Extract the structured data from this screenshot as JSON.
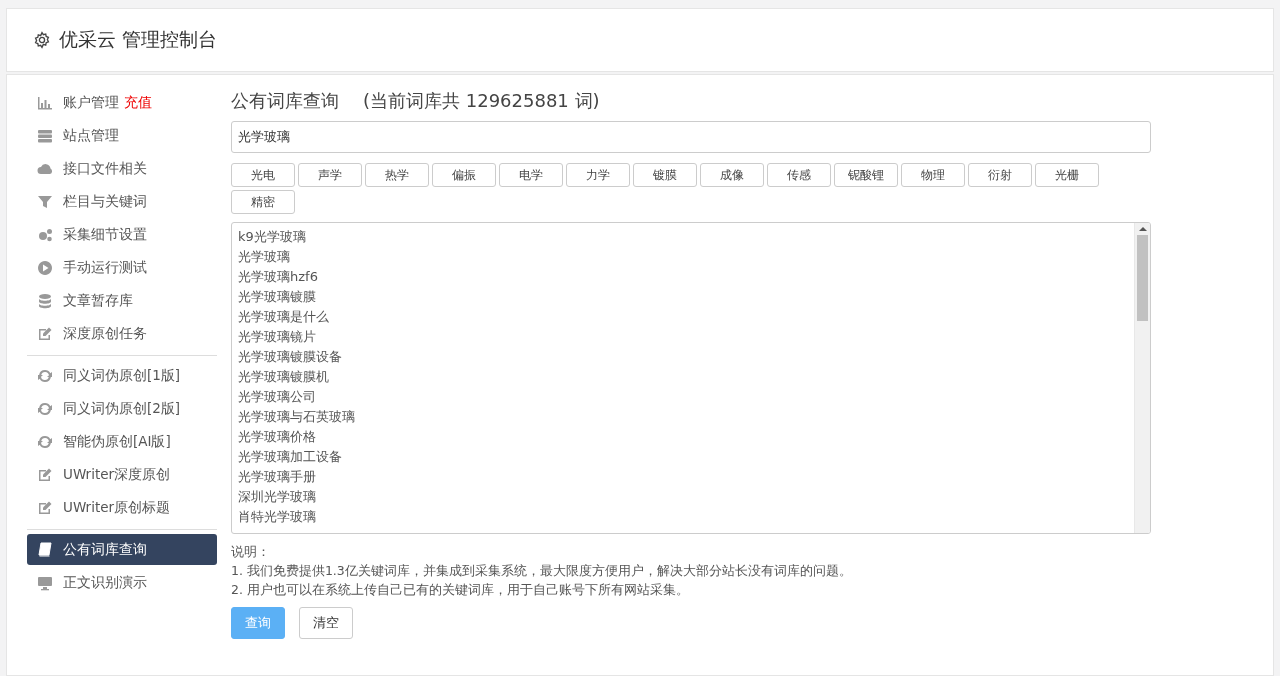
{
  "header": {
    "title": "优采云 管理控制台"
  },
  "sidebar": {
    "groups": [
      [
        {
          "label": "账户管理",
          "badge": "充值",
          "selected": false
        },
        {
          "label": "站点管理",
          "selected": false
        },
        {
          "label": "接口文件相关",
          "selected": false
        },
        {
          "label": "栏目与关键词",
          "selected": false
        },
        {
          "label": "采集细节设置",
          "selected": false
        },
        {
          "label": "手动运行测试",
          "selected": false
        },
        {
          "label": "文章暂存库",
          "selected": false
        },
        {
          "label": "深度原创任务",
          "selected": false
        }
      ],
      [
        {
          "label": "同义词伪原创[1版]",
          "selected": false
        },
        {
          "label": "同义词伪原创[2版]",
          "selected": false
        },
        {
          "label": "智能伪原创[AI版]",
          "selected": false
        },
        {
          "label": "UWriter深度原创",
          "selected": false
        },
        {
          "label": "UWriter原创标题",
          "selected": false
        }
      ],
      [
        {
          "label": "公有词库查询",
          "selected": true
        },
        {
          "label": "正文识别演示",
          "selected": false
        }
      ]
    ]
  },
  "main": {
    "title": "公有词库查询",
    "count_text": "(当前词库共 129625881 词)",
    "search": {
      "value": "光学玻璃"
    },
    "tags": [
      "光电",
      "声学",
      "热学",
      "偏振",
      "电学",
      "力学",
      "镀膜",
      "成像",
      "传感",
      "铌酸锂",
      "物理",
      "衍射",
      "光栅",
      "精密"
    ],
    "results": [
      "k9光学玻璃",
      "光学玻璃",
      "光学玻璃hzf6",
      "光学玻璃镀膜",
      "光学玻璃是什么",
      "光学玻璃镜片",
      "光学玻璃镀膜设备",
      "光学玻璃镀膜机",
      "光学玻璃公司",
      "光学玻璃与石英玻璃",
      "光学玻璃价格",
      "光学玻璃加工设备",
      "光学玻璃手册",
      "深圳光学玻璃",
      "肖特光学玻璃"
    ],
    "notes_title": "说明：",
    "notes": [
      "1. 我们免费提供1.3亿关键词库，并集成到采集系统，最大限度方便用户，解决大部分站长没有词库的问题。",
      "2. 用户也可以在系统上传自己已有的关键词库，用于自己账号下所有网站采集。"
    ],
    "buttons": [
      {
        "label": "查询",
        "kind": "primary"
      },
      {
        "label": "清空",
        "kind": "default"
      }
    ]
  }
}
